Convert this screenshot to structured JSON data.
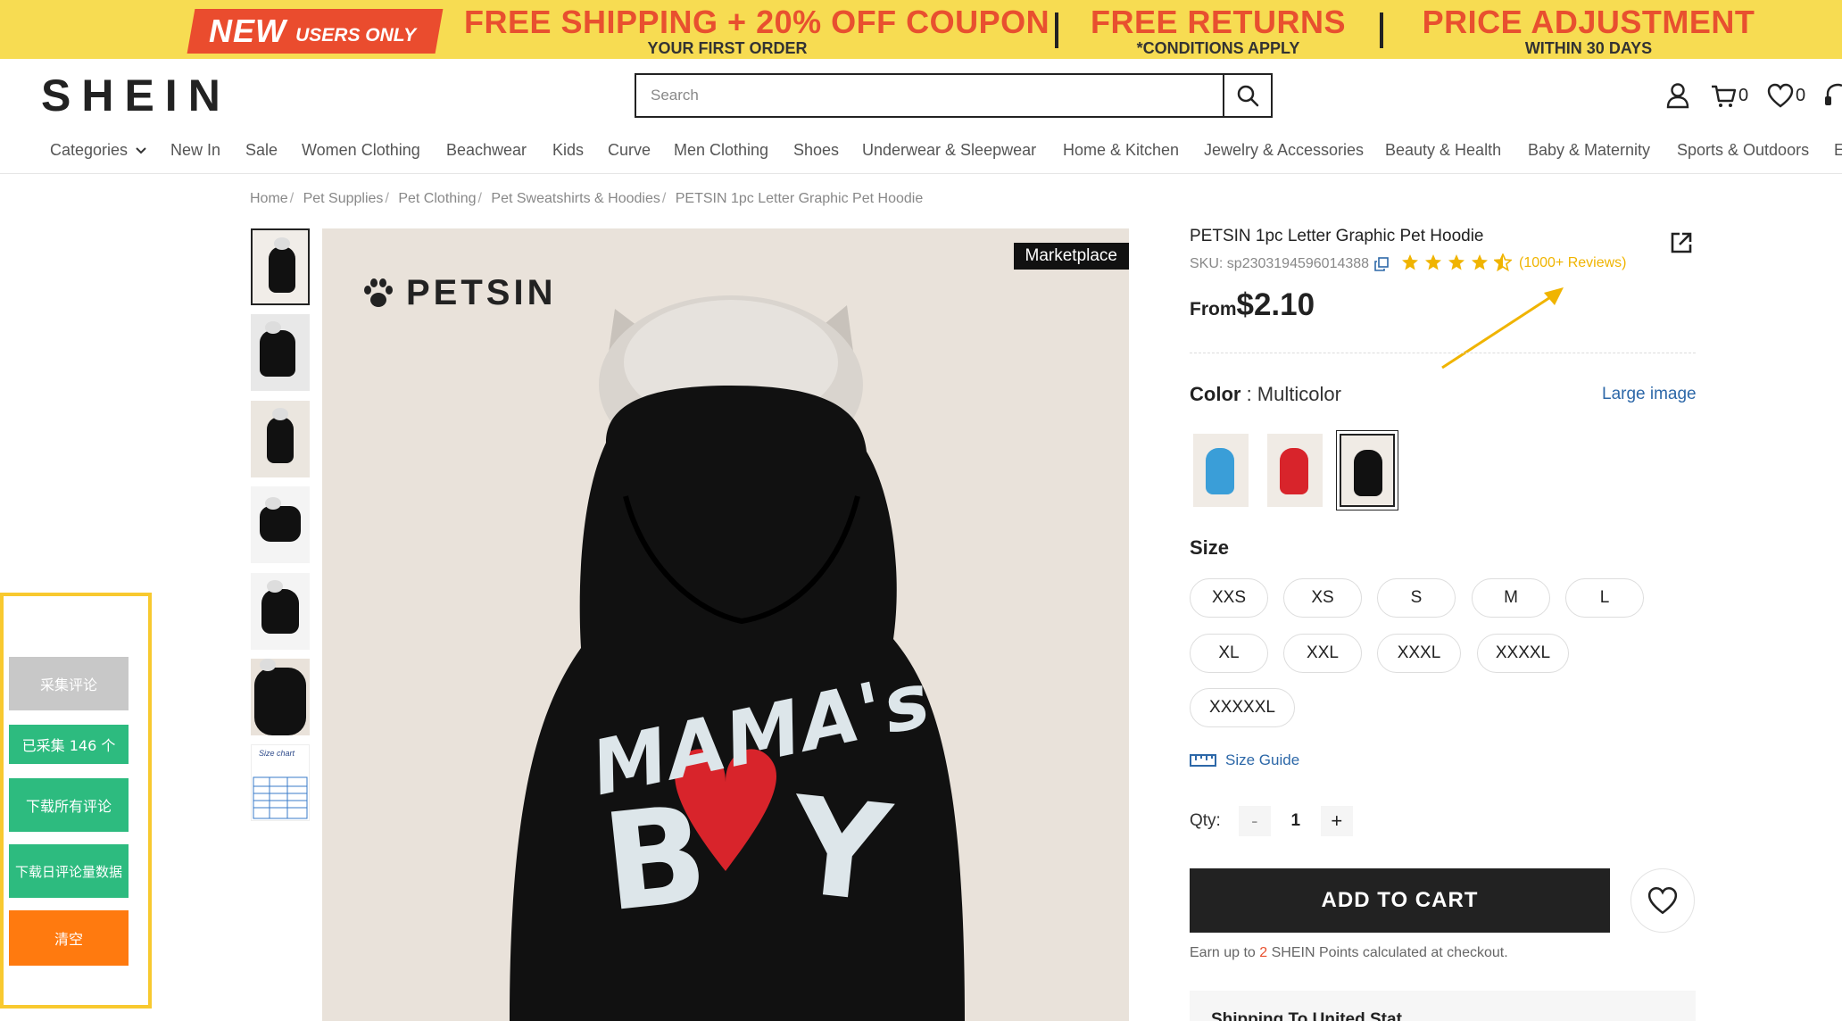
{
  "promo": {
    "new_big": "NEW",
    "new_small": "USERS ONLY",
    "offer1_title": "FREE SHIPPING + 20% OFF COUPON",
    "offer1_sub": "YOUR FIRST ORDER",
    "offer2_title": "FREE RETURNS",
    "offer2_sub": "*CONDITIONS APPLY",
    "offer3_title": "PRICE ADJUSTMENT",
    "offer3_sub": "WITHIN 30 DAYS"
  },
  "header": {
    "logo": "SHEIN",
    "search_placeholder": "Search",
    "cart_count": "0",
    "wishlist_count": "0"
  },
  "nav": [
    "Categories",
    "New In",
    "Sale",
    "Women Clothing",
    "Beachwear",
    "Kids",
    "Curve",
    "Men Clothing",
    "Shoes",
    "Underwear & Sleepwear",
    "Home & Kitchen",
    "Jewelry & Accessories",
    "Beauty & Health",
    "Baby & Maternity",
    "Sports & Outdoors",
    "E"
  ],
  "breadcrumb": {
    "items": [
      "Home",
      "Pet Supplies",
      "Pet Clothing",
      "Pet Sweatshirts & Hoodies"
    ],
    "current": "PETSIN 1pc Letter Graphic Pet Hoodie"
  },
  "gallery": {
    "brand": "PETSIN",
    "badge": "Marketplace",
    "hoodie_text_line1": "MAMA's",
    "hoodie_text_line2": "B",
    "hoodie_text_line3": "Y",
    "thumb_mini_text": "Size chart"
  },
  "product": {
    "title": "PETSIN 1pc Letter Graphic Pet Hoodie",
    "sku": "SKU: sp2303194596014388",
    "rating": 4.5,
    "reviews": "(1000+ Reviews)",
    "price_prefix": "From",
    "price": "$2.10",
    "color_label": "Color",
    "color_value": ": Multicolor",
    "large_image": "Large image",
    "swatches": [
      {
        "name": "blue",
        "color": "#3a9ed8"
      },
      {
        "name": "red",
        "color": "#d8242b"
      },
      {
        "name": "black",
        "color": "#111111"
      }
    ],
    "selected_swatch": "black",
    "size_label": "Size",
    "sizes": [
      "XXS",
      "XS",
      "S",
      "M",
      "L",
      "XL",
      "XXL",
      "XXXL",
      "XXXXL",
      "XXXXXL"
    ],
    "size_guide": "Size Guide",
    "qty_label": "Qty:",
    "qty_minus": "-",
    "qty_plus": "+",
    "qty": "1",
    "add_to_cart": "ADD TO CART",
    "points_pre": "Earn up to ",
    "points_num": "2",
    "points_post": " SHEIN Points calculated at checkout.",
    "shipping_partial": "Shipping To United Stat"
  },
  "scraper_panel": {
    "collect_reviews": "采集评论",
    "collected": "已采集 146 个",
    "download_all": "下载所有评论",
    "download_daily": "下载日评论量数据",
    "clear": "清空"
  },
  "colors": {
    "promo_bg": "#f7dc52",
    "promo_red": "#e8502f",
    "accent_blue": "#2d68a8",
    "star_yellow": "#f0b400",
    "panel_border": "#f8c92f",
    "panel_gray": "#c8c8c8",
    "panel_green": "#2dbb7f",
    "panel_orange": "#ff7a0f"
  }
}
